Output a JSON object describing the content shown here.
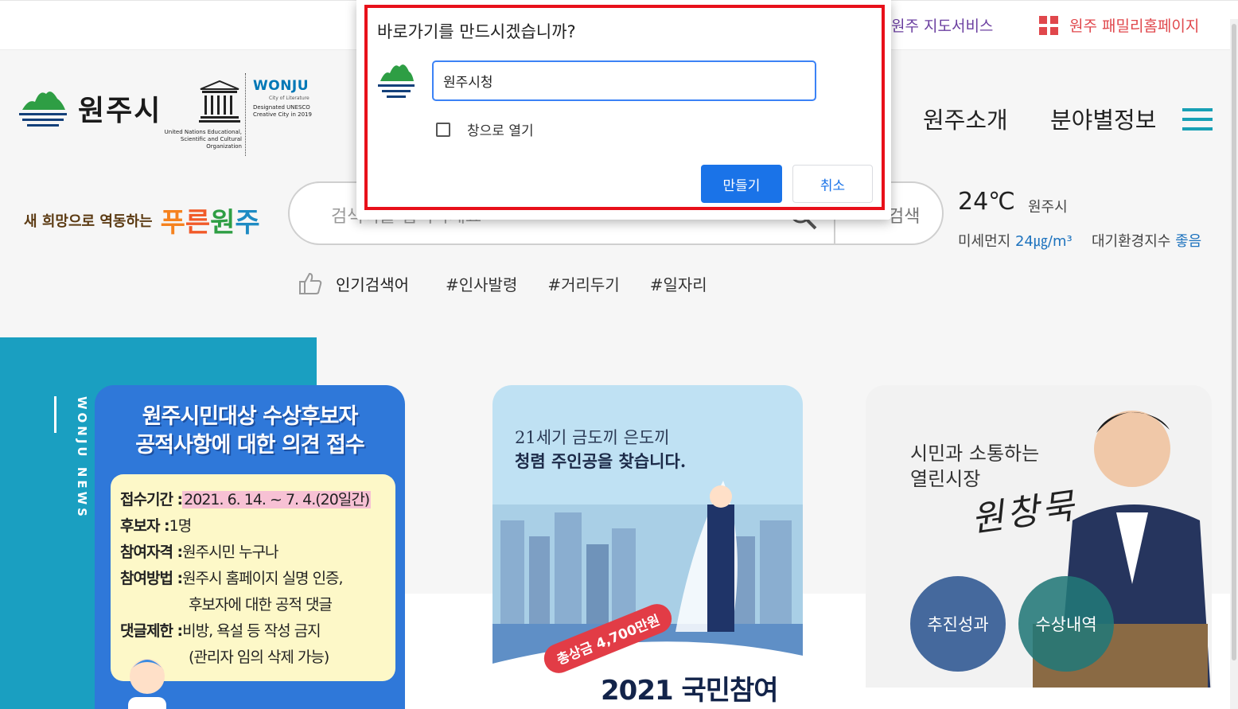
{
  "topbar": {
    "map_service": "원주 지도서비스",
    "family_homepage": "원주 패밀리홈페이지"
  },
  "logo": {
    "city_name": "원주시",
    "unesco_caption": "United Nations Educational, Scientific and Cultural Organization",
    "wonju_title": "WONJU",
    "wonju_subtitle": "City of Literature",
    "wonju_caption": "Designated UNESCO Creative City in 2019"
  },
  "nav": {
    "intro": "원주소개",
    "fields": "분야별정보"
  },
  "slogan": {
    "small": "새 희망으로 역동하는",
    "big": [
      "푸",
      "른",
      "원",
      "주"
    ]
  },
  "search": {
    "placeholder": "검색어를 입력하세요",
    "button_label": "검색"
  },
  "weather": {
    "temperature": "24℃",
    "city": "원주시",
    "dust_label": "미세먼지",
    "dust_value": "24㎍/m³",
    "air_label": "대기환경지수",
    "air_value": "좋음"
  },
  "popular": {
    "label": "인기검색어",
    "keywords": [
      "#인사발령",
      "#거리두기",
      "#일자리"
    ]
  },
  "news": {
    "label": "WONJU NEWS",
    "card1": {
      "title_line1": "원주시민대상 수상후보자",
      "title_line2": "공적사항에 대한 의견 접수",
      "period_label": "접수기간 :",
      "period_value": "2021. 6. 14. ~ 7. 4.(20일간)",
      "candidate_label": "후보자 :",
      "candidate_value": "1명",
      "eligibility_label": "참여자격 :",
      "eligibility_value": "원주시민 누구나",
      "method_label": "참여방법 :",
      "method_value1": "원주시 홈페이지 실명 인증,",
      "method_value2": "후보자에 대한 공적 댓글",
      "limit_label": "댓글제한 :",
      "limit_value1": "비방, 욕설 등 작성 금지",
      "limit_value2": "(관리자 임의 삭제 가능)"
    },
    "card2": {
      "line1": "21세기 금도끼 은도끼",
      "line2": "청렴 주인공을 찾습니다.",
      "prize": "총상금 4,700만원",
      "big": "2021 국민참여"
    },
    "card3": {
      "line1": "시민과 소통하는",
      "line2": "열린시장",
      "signature": "원창묵",
      "btn_achievements": "추진성과",
      "btn_awards": "수상내역"
    }
  },
  "dialog": {
    "title": "바로가기를 만드시겠습니까?",
    "name_value": "원주시청",
    "open_as_window": "창으로 열기",
    "create": "만들기",
    "cancel": "취소"
  },
  "colors": {
    "accent_blue": "#1a73e8",
    "highlight_red": "#e8101a",
    "news_teal": "#1a9fc1"
  }
}
